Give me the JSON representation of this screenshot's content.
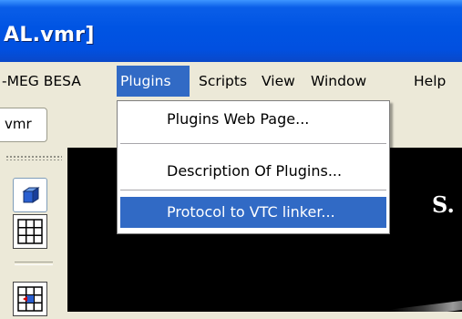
{
  "window": {
    "title": "AL.vmr]"
  },
  "menubar": {
    "items": [
      {
        "label": "-MEG BESA"
      },
      {
        "label": "Plugins"
      },
      {
        "label": "Scripts"
      },
      {
        "label": "View"
      },
      {
        "label": "Window"
      },
      {
        "label": "Help"
      }
    ]
  },
  "document_tab": {
    "label": "vmr"
  },
  "plugins_menu": {
    "items": [
      {
        "label": "Plugins Web Page..."
      },
      {
        "label": "Description Of Plugins..."
      },
      {
        "label": "Protocol to VTC linker...",
        "highlighted": true
      }
    ]
  },
  "viewer": {
    "overlay_text": "S."
  },
  "colors": {
    "selection": "#316ac5",
    "titlebar": "#0054e3",
    "chrome": "#ece9d8",
    "viewer_bg": "#000000"
  },
  "icons": [
    "3d-box-icon",
    "grid-icon",
    "selection-icon"
  ]
}
